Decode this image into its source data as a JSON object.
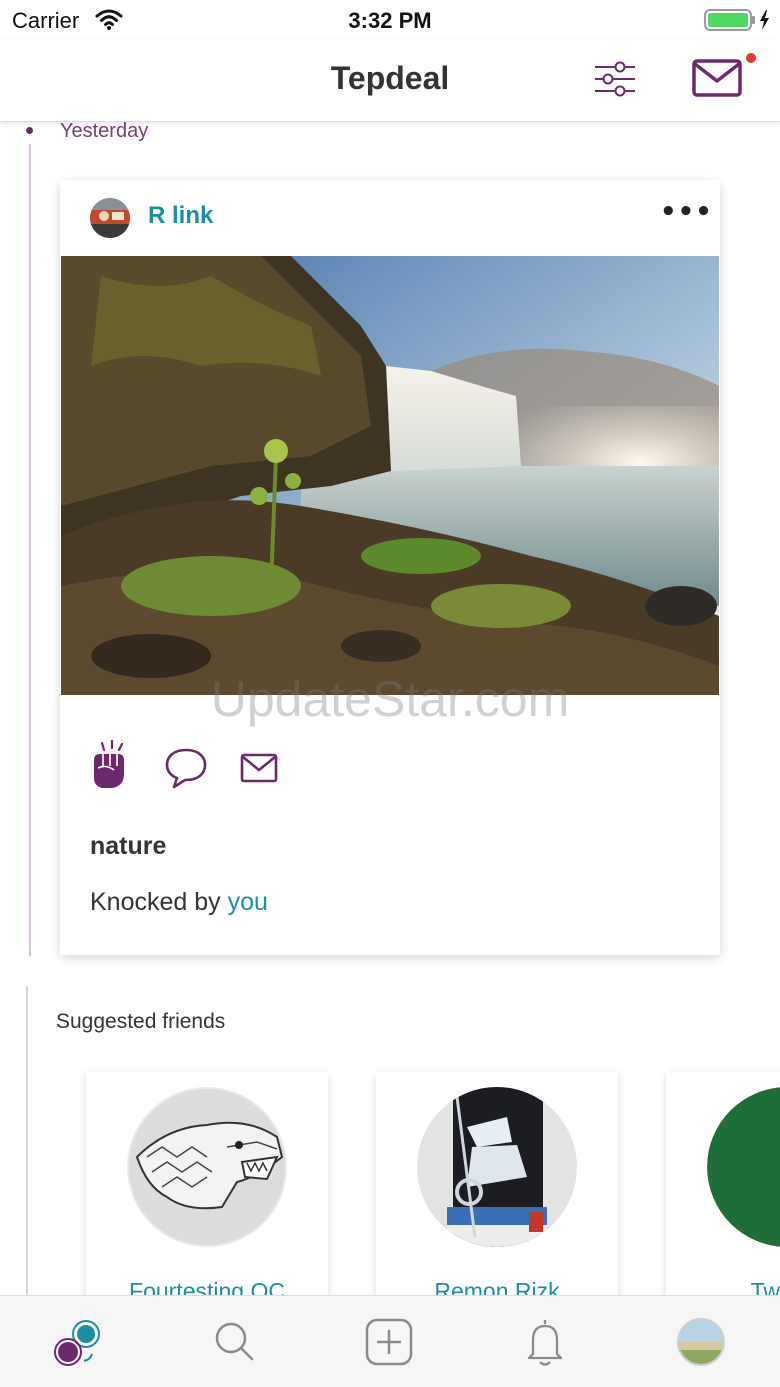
{
  "status_bar": {
    "carrier": "Carrier",
    "time": "3:32 PM"
  },
  "nav": {
    "title": "Tepdeal",
    "has_unread_messages": true
  },
  "feed": {
    "date_label": "Yesterday",
    "post": {
      "author": "R link",
      "more_label": "•••",
      "caption": "nature",
      "knocked_prefix": "Knocked by",
      "knocked_by": "you",
      "watermark": "UpdateStar.com"
    },
    "suggested": {
      "title": "Suggested friends",
      "friends": [
        {
          "name": "Fourtesting OC"
        },
        {
          "name": "Remon Rizk"
        },
        {
          "name": "Twotes"
        }
      ]
    }
  },
  "tab_bar": {
    "tabs": [
      {
        "icon": "feed-logo-icon",
        "active": true
      },
      {
        "icon": "search-icon"
      },
      {
        "icon": "add-post-icon"
      },
      {
        "icon": "bell-icon"
      },
      {
        "icon": "profile-avatar-icon"
      }
    ]
  },
  "colors": {
    "accent_purple": "#6b2a6b",
    "link_teal": "#1d8fa0",
    "notification_red": "#e53935",
    "battery_green": "#4cd964"
  }
}
